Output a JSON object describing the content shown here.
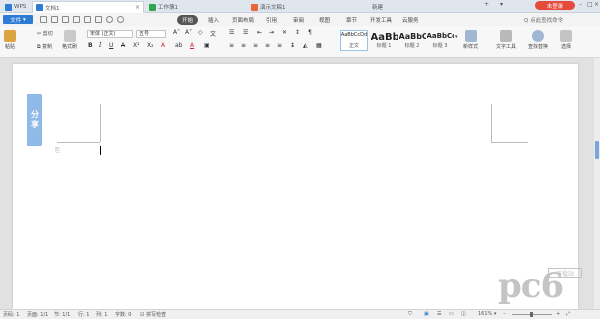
{
  "tabs": [
    {
      "label": "WPS",
      "color": "#2e7bd4"
    },
    {
      "label": "文档1",
      "color": "#2e7bd4"
    },
    {
      "label": "工作簿1",
      "color": "#2fa552"
    },
    {
      "label": "演示文稿1",
      "color": "#e8683a"
    },
    {
      "label": "新建",
      "color": ""
    }
  ],
  "login_label": "未登录",
  "menu": {
    "file": "文件",
    "items": [
      "开始",
      "插入",
      "页面布局",
      "引用",
      "审阅",
      "视图",
      "章节",
      "开发工具",
      "云服务"
    ],
    "search": "Q 点此查找命令"
  },
  "ribbon": {
    "paste": "粘贴",
    "cut": "剪切",
    "copy": "复制",
    "format_painter": "格式刷",
    "font_name": "宋体 (正文)",
    "font_size": "五号",
    "styles": [
      {
        "preview": "AaBbCcDd",
        "caption": "正文"
      },
      {
        "preview": "AaBb",
        "caption": "标题 1"
      },
      {
        "preview": "AaBbC",
        "caption": "标题 2"
      },
      {
        "preview": "AaBbCc",
        "caption": "标题 3"
      }
    ],
    "new_style": "新样式",
    "text_tools": "文字工具",
    "find_replace": "查找替换",
    "select": "选择"
  },
  "share_label": "分享",
  "status": {
    "page": "页码: 1",
    "pages": "页面: 1/1",
    "section": "节: 1/1",
    "row": "行: 1",
    "col": "列: 1",
    "words": "字数: 0",
    "spell": "拼写检查",
    "zoom": "161%"
  },
  "watermark": {
    "logo": "pc6",
    "sub": "下载站"
  }
}
